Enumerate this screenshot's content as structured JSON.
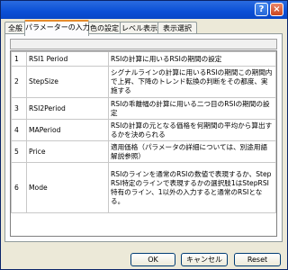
{
  "window": {
    "help_label": "?",
    "close_label": "×"
  },
  "tabs": [
    {
      "label": "全般"
    },
    {
      "label": "パラメーターの入力"
    },
    {
      "label": "色の設定"
    },
    {
      "label": "レベル表示"
    },
    {
      "label": "表示選択"
    }
  ],
  "params": [
    {
      "no": "1",
      "name": "RSI1 Period",
      "desc": "RSIの計算に用いるRSIの期間の設定"
    },
    {
      "no": "2",
      "name": "StepSize",
      "desc": "シグナルラインの計算に用いるRSIの期間この期間内で上昇、下降のトレンド転換の判断をその都度、実施する"
    },
    {
      "no": "3",
      "name": "RSI2Period",
      "desc": "RSIの乖離幅の計算に用いる二つ目のRSIの期間の設定"
    },
    {
      "no": "4",
      "name": "MAPeriod",
      "desc": "RSIの計算の元となる価格を何期間の平均から算出するかを決められる"
    },
    {
      "no": "5",
      "name": "Price",
      "desc": "適用価格（パラメータの詳細については、別途用語解説参照）"
    },
    {
      "no": "6",
      "name": "Mode",
      "desc": "RSIのラインを通常のRSIの数値で表現するか、StepRSI特定のラインで表現するかの選択肢1はStepRSI特有のライン、1以外の入力すると通常のRSIとなる。"
    }
  ],
  "buttons": {
    "ok": "OK",
    "cancel": "キャンセル",
    "reset": "Reset"
  }
}
